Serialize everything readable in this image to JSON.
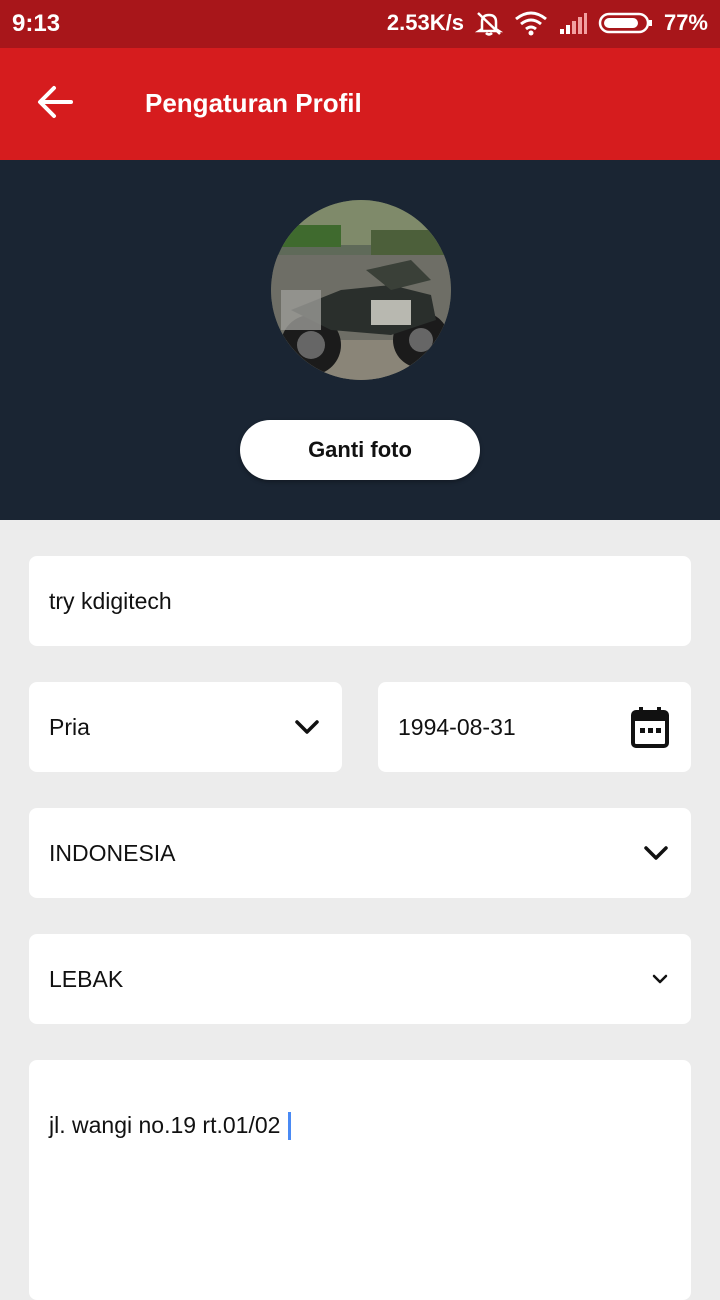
{
  "status_bar": {
    "time": "9:13",
    "network_speed": "2.53K/s",
    "battery": "77%",
    "battery_level": 0.77,
    "icons": [
      "mute-icon",
      "wifi-icon",
      "signal-icon",
      "battery-icon"
    ]
  },
  "app_bar": {
    "title": "Pengaturan Profil",
    "back_icon": "arrow-left-icon",
    "color": "#d61c1e"
  },
  "profile": {
    "photo_description": "motorcycle",
    "change_photo_label": "Ganti foto"
  },
  "form": {
    "name": "try kdigitech",
    "gender": "Pria",
    "birth_date": "1994-08-31",
    "country": "INDONESIA",
    "city": "LEBAK",
    "address": "jl. wangi no.19 rt.01/02"
  },
  "colors": {
    "status_bar": "#a8161a",
    "header_panel": "#1a2533",
    "background": "#ececec",
    "cursor": "#4a8af4"
  }
}
